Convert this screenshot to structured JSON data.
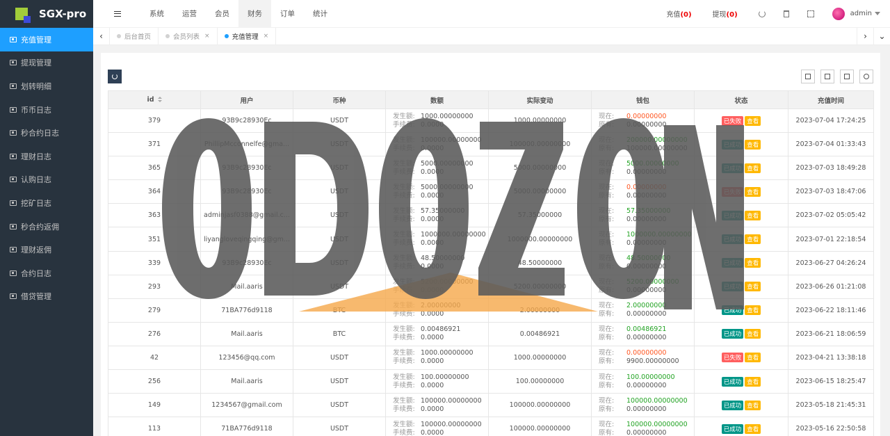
{
  "app": {
    "name": "SGX-pro"
  },
  "sidebar": {
    "items": [
      {
        "label": "充值管理",
        "active": true
      },
      {
        "label": "提现管理"
      },
      {
        "label": "划转明细"
      },
      {
        "label": "币币日志"
      },
      {
        "label": "秒合约日志"
      },
      {
        "label": "理财日志"
      },
      {
        "label": "认购日志"
      },
      {
        "label": "挖矿日志"
      },
      {
        "label": "秒合约返佣"
      },
      {
        "label": "理财返佣"
      },
      {
        "label": "合约日志"
      },
      {
        "label": "借贷管理"
      }
    ]
  },
  "topnav": {
    "items": [
      "系统",
      "运营",
      "会员",
      "财务",
      "订单",
      "统计"
    ],
    "active": "财务"
  },
  "topright": {
    "recharge_label": "充值",
    "recharge_count": "(0)",
    "withdraw_label": "提现",
    "withdraw_count": "(0)",
    "username": "admin"
  },
  "tabs": [
    {
      "label": "后台首页",
      "closable": false
    },
    {
      "label": "会员列表",
      "closable": true
    },
    {
      "label": "充值管理",
      "closable": true,
      "active": true
    }
  ],
  "table": {
    "headers": [
      "id",
      "用户",
      "币种",
      "数额",
      "实际变动",
      "钱包",
      "状态",
      "充值时间"
    ],
    "amount_label": "发生额:",
    "fee_label": "手续费:",
    "now_label": "现在:",
    "orig_label": "原有:",
    "success_label": "已成功",
    "fail_label": "已失败",
    "view_label": "查看",
    "rows": [
      {
        "id": "379",
        "user": "93B9c28930Ec",
        "coin": "USDT",
        "amount": "1000.00000000",
        "fee": "0.0000",
        "actual": "1000.00000000",
        "now": "0.00000000",
        "orig": "0.00000000",
        "status": "fail",
        "time": "2023-07-04 17:24:25"
      },
      {
        "id": "371",
        "user": "PhillipMcconnelfe@gma...",
        "coin": "USDT",
        "amount": "100000.00000000",
        "fee": "0.0000",
        "actual": "100000.00000000",
        "now": "200000.00000000",
        "orig": "100000.00000000",
        "status": "ok",
        "time": "2023-07-04 01:33:43"
      },
      {
        "id": "365",
        "user": "93B9c28930Ec",
        "coin": "USDT",
        "amount": "5000.00000000",
        "fee": "0.0000",
        "actual": "5000.00000000",
        "now": "5000.00000000",
        "orig": "0.00000000",
        "status": "ok",
        "time": "2023-07-03 18:49:28"
      },
      {
        "id": "364",
        "user": "93B9c28930Ec",
        "coin": "USDT",
        "amount": "5000.00000000",
        "fee": "0.0000",
        "actual": "5000.00000000",
        "now": "0.00000000",
        "orig": "0.00000000",
        "status": "fail",
        "time": "2023-07-03 18:47:06"
      },
      {
        "id": "363",
        "user": "adminjasf0388@gmail.c...",
        "coin": "USDT",
        "amount": "57.35000000",
        "fee": "0.0000",
        "actual": "57.35000000",
        "now": "57.35000000",
        "orig": "0.00000000",
        "status": "ok",
        "time": "2023-07-02 05:05:42"
      },
      {
        "id": "351",
        "user": "liyangloveqingqing@gm...",
        "coin": "USDT",
        "amount": "1000000.00000000",
        "fee": "0.0000",
        "actual": "1000000.00000000",
        "now": "1000000.00000000",
        "orig": "0.00000000",
        "status": "ok",
        "time": "2023-07-01 22:18:54"
      },
      {
        "id": "339",
        "user": "93B9c28930Ec",
        "coin": "USDT",
        "amount": "48.50000000",
        "fee": "0.0000",
        "actual": "48.50000000",
        "now": "48.50000000",
        "orig": "0.00000000",
        "status": "ok",
        "time": "2023-06-27 04:26:24"
      },
      {
        "id": "293",
        "user": "Mail.aaris",
        "coin": "USDT",
        "amount": "5200.00000000",
        "fee": "0.0000",
        "actual": "5200.00000000",
        "now": "5200.00000000",
        "orig": "0.00000000",
        "status": "ok",
        "time": "2023-06-26 01:21:08"
      },
      {
        "id": "279",
        "user": "71BA776d9118",
        "coin": "BTC",
        "amount": "2.00000000",
        "fee": "0.0000",
        "actual": "2.00000000",
        "now": "2.00000000",
        "orig": "0.00000000",
        "status": "ok",
        "time": "2023-06-22 18:11:46"
      },
      {
        "id": "276",
        "user": "Mail.aaris",
        "coin": "BTC",
        "amount": "0.00486921",
        "fee": "0.0000",
        "actual": "0.00486921",
        "now": "0.00486921",
        "orig": "0.00000000",
        "status": "ok",
        "time": "2023-06-21 18:06:59"
      },
      {
        "id": "42",
        "user": "123456@qq.com",
        "coin": "USDT",
        "amount": "1000.00000000",
        "fee": "0.0000",
        "actual": "1000.00000000",
        "now": "0.00000000",
        "orig": "9900.00000000",
        "status": "fail",
        "time": "2023-04-21 13:38:18"
      },
      {
        "id": "256",
        "user": "Mail.aaris",
        "coin": "USDT",
        "amount": "100.00000000",
        "fee": "0.0000",
        "actual": "100.00000000",
        "now": "100.00000000",
        "orig": "0.00000000",
        "status": "ok",
        "time": "2023-06-15 18:25:47"
      },
      {
        "id": "149",
        "user": "1234567@gmail.com",
        "coin": "USDT",
        "amount": "100000.00000000",
        "fee": "0.0000",
        "actual": "100000.00000000",
        "now": "100000.00000000",
        "orig": "0.00000000",
        "status": "ok",
        "time": "2023-05-18 21:45:31"
      },
      {
        "id": "113",
        "user": "71BA776d9118",
        "coin": "USDT",
        "amount": "100000.00000000",
        "fee": "0.0000",
        "actual": "100000.00000000",
        "now": "100000.00000000",
        "orig": "0.00000000",
        "status": "ok",
        "time": "2023-05-16 22:50:58"
      }
    ]
  },
  "watermark": {
    "text": "ODOZON",
    "color": "#5a5a5a",
    "accent": "#f5a84a"
  },
  "colors": {
    "sidebar_bg": "#28333e",
    "accent": "#1e9fff",
    "success": "#009688",
    "fail": "#ff5f5f",
    "view": "#ffb800"
  }
}
